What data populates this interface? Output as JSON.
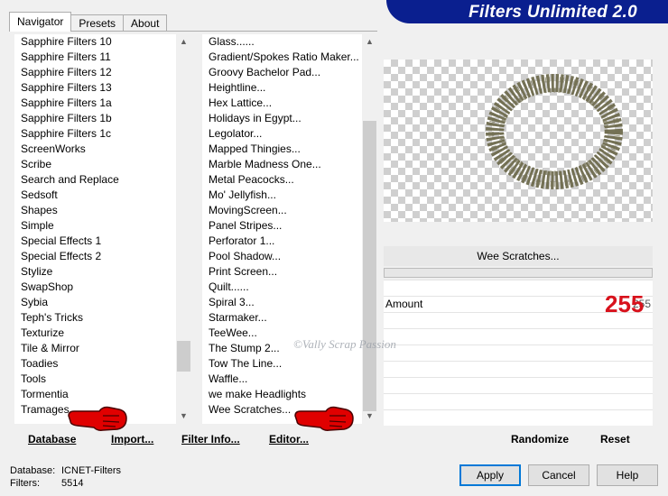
{
  "tabs": [
    {
      "label": "Navigator",
      "active": true
    },
    {
      "label": "Presets",
      "active": false
    },
    {
      "label": "About",
      "active": false
    }
  ],
  "banner": {
    "title": "Filters Unlimited 2.0"
  },
  "categories": {
    "items": [
      "Sapphire Filters 10",
      "Sapphire Filters 11",
      "Sapphire Filters 12",
      "Sapphire Filters 13",
      "Sapphire Filters 1a",
      "Sapphire Filters 1b",
      "Sapphire Filters 1c",
      "ScreenWorks",
      "Scribe",
      "Search and Replace",
      "Sedsoft",
      "Shapes",
      "Simple",
      "Special Effects 1",
      "Special Effects 2",
      "Stylize",
      "SwapShop",
      "Sybia",
      "Teph's Tricks",
      "Texturize",
      "Tile & Mirror",
      "Toadies",
      "Tools",
      "Tormentia",
      "Tramages"
    ],
    "selected": "Tramages",
    "scroll_position": 0.9
  },
  "filters": {
    "items": [
      "Glass......",
      "Gradient/Spokes Ratio Maker...",
      "Groovy Bachelor Pad...",
      "Heightline...",
      "Hex Lattice...",
      "Holidays in Egypt...",
      "Legolator...",
      "Mapped Thingies...",
      "Marble Madness One...",
      "Metal Peacocks...",
      "Mo' Jellyfish...",
      "MovingScreen...",
      "Panel Stripes...",
      "Perforator 1...",
      "Pool Shadow...",
      "Print Screen...",
      "Quilt......",
      "Spiral 3...",
      "Starmaker...",
      "TeeWee...",
      "The Stump 2...",
      "Tow The Line...",
      "Waffle...",
      "we make Headlights",
      "Wee Scratches..."
    ],
    "selected": "Wee Scratches...",
    "scroll_position": 0.45
  },
  "list_buttons": {
    "database": "Database",
    "import": "Import...",
    "filter_info": "Filter Info...",
    "editor": "Editor..."
  },
  "filter_panel": {
    "name": "Wee Scratches...",
    "param_label": "Amount",
    "param_value": "255",
    "param_value_highlight": "255",
    "watermark": "©Vally Scrap Passion"
  },
  "right_buttons": {
    "randomize": "Randomize",
    "reset": "Reset"
  },
  "status": {
    "database_label": "Database:",
    "database_value": "ICNET-Filters",
    "filters_label": "Filters:",
    "filters_value": "5514"
  },
  "dialog_buttons": {
    "apply": "Apply",
    "cancel": "Cancel",
    "help": "Help"
  },
  "colors": {
    "banner": "#0a1f8f",
    "highlight": "#d8121c",
    "ring": "#6f6c4e"
  },
  "icons": {
    "scroll_up": "▲",
    "scroll_down": "▼"
  }
}
